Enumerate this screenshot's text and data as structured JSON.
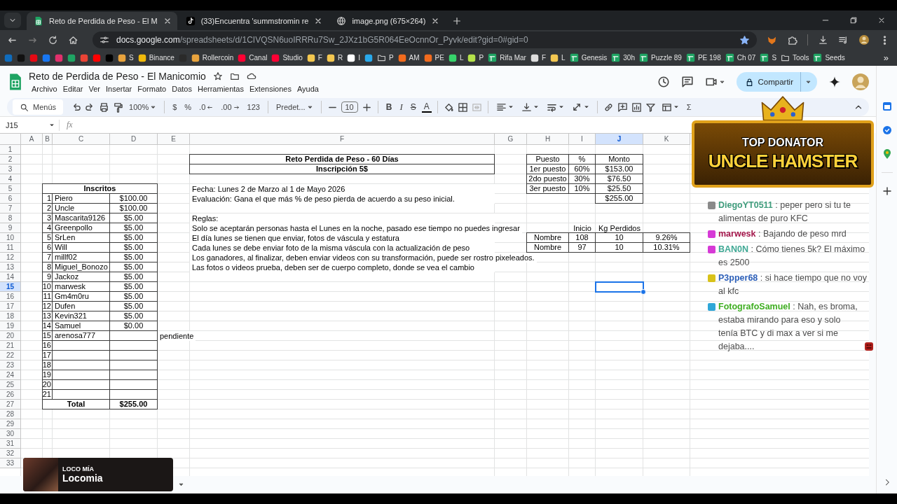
{
  "browser": {
    "tabs": [
      {
        "title": "Reto de Perdida de Peso - El M",
        "kind": "sheets",
        "selected": true
      },
      {
        "title": "(33)Encuentra 'summstromin re",
        "kind": "tiktok",
        "selected": false
      },
      {
        "title": "image.png (675×264)",
        "kind": "globe",
        "selected": false
      }
    ],
    "url": {
      "host": "docs.google.com",
      "path": "/spreadsheets/d/1CIVQSN6uoIRRRu7Sw_2JXz1bG5R064EeOcnnOr_Pyvk/edit?gid=0#gid=0"
    },
    "bookmarks": [
      {
        "kind": "site",
        "color": "#0f6cbd"
      },
      {
        "kind": "site",
        "color": "#111111"
      },
      {
        "kind": "site",
        "color": "#e50914"
      },
      {
        "kind": "site",
        "color": "#1877f2"
      },
      {
        "kind": "site",
        "color": "#e1306c"
      },
      {
        "kind": "site",
        "color": "#1fa463"
      },
      {
        "kind": "site",
        "color": "#ea4335"
      },
      {
        "kind": "site",
        "color": "#ff0000"
      },
      {
        "kind": "site",
        "color": "#000000"
      },
      {
        "kind": "site",
        "color": "#e8a33d",
        "label": "S"
      },
      {
        "kind": "site",
        "color": "#f0b90b",
        "label": "Binance"
      },
      {
        "kind": "site",
        "color": "#2a2a2a"
      },
      {
        "kind": "site",
        "color": "#e8a33d",
        "label": "Rollercoin"
      },
      {
        "kind": "site",
        "color": "#ff0033",
        "label": "Canal"
      },
      {
        "kind": "site",
        "color": "#ff0034",
        "label": "Studio"
      },
      {
        "kind": "site",
        "color": "#f3c74f",
        "label": "F"
      },
      {
        "kind": "site",
        "color": "#f3c750",
        "label": "R"
      },
      {
        "kind": "site",
        "color": "#ffffff",
        "label": "I"
      },
      {
        "kind": "site",
        "color": "#29a9eb"
      },
      {
        "kind": "folder",
        "label": "P"
      },
      {
        "kind": "site",
        "color": "#f26b1d",
        "label": "AM"
      },
      {
        "kind": "site",
        "color": "#f26b1e",
        "label": "PE"
      },
      {
        "kind": "site",
        "color": "#37d36b",
        "label": "L"
      },
      {
        "kind": "site",
        "color": "#b5e24a",
        "label": "P"
      },
      {
        "kind": "sheets",
        "label": "Rifa Mar"
      },
      {
        "kind": "site",
        "color": "#dddddd",
        "label": "F"
      },
      {
        "kind": "site",
        "color": "#f3c751",
        "label": "L"
      },
      {
        "kind": "sheets",
        "label": "Genesis"
      },
      {
        "kind": "sheets",
        "label": "30h"
      },
      {
        "kind": "sheets",
        "label": "Puzzle 89"
      },
      {
        "kind": "sheets",
        "label": "PE 198"
      },
      {
        "kind": "sheets",
        "label": "Ch 07"
      },
      {
        "kind": "sheets",
        "label": "S"
      },
      {
        "kind": "folder",
        "label": "Tools"
      },
      {
        "kind": "sheets",
        "label": "Seeds"
      }
    ],
    "more": "»"
  },
  "doc": {
    "title": "Reto de Perdida de Peso - El Manicomio",
    "menus": [
      "Archivo",
      "Editar",
      "Ver",
      "Insertar",
      "Formato",
      "Datos",
      "Herramientas",
      "Extensiones",
      "Ayuda"
    ],
    "share": "Compartir"
  },
  "toolbar": [
    {
      "kind": "search",
      "label": "Menús"
    },
    {
      "kind": "undo"
    },
    {
      "kind": "redo"
    },
    {
      "kind": "print"
    },
    {
      "kind": "paint"
    },
    {
      "kind": "select",
      "label": "100%"
    },
    {
      "kind": "sep"
    },
    {
      "kind": "text",
      "label": "$"
    },
    {
      "kind": "text",
      "label": "%"
    },
    {
      "kind": "decrease",
      "label": ".0"
    },
    {
      "kind": "increase",
      "label": ".00"
    },
    {
      "kind": "text",
      "label": "123"
    },
    {
      "kind": "sep"
    },
    {
      "kind": "select",
      "label": "Predet..."
    },
    {
      "kind": "sep"
    },
    {
      "kind": "minus"
    },
    {
      "kind": "size",
      "label": "10"
    },
    {
      "kind": "plus"
    },
    {
      "kind": "sep"
    },
    {
      "kind": "bold",
      "label": "B"
    },
    {
      "kind": "italic",
      "label": "I"
    },
    {
      "kind": "strike",
      "label": "S"
    },
    {
      "kind": "color",
      "label": "A"
    },
    {
      "kind": "sep"
    },
    {
      "kind": "fill"
    },
    {
      "kind": "borders"
    },
    {
      "kind": "merge"
    },
    {
      "kind": "sep"
    },
    {
      "kind": "align"
    },
    {
      "kind": "valign"
    },
    {
      "kind": "wrap"
    },
    {
      "kind": "rotate"
    },
    {
      "kind": "sep"
    },
    {
      "kind": "link"
    },
    {
      "kind": "comment"
    },
    {
      "kind": "chart"
    },
    {
      "kind": "filter"
    },
    {
      "kind": "views"
    },
    {
      "kind": "sigma",
      "label": "Σ"
    },
    {
      "kind": "collapse"
    }
  ],
  "formula_bar": {
    "name_box": "J15",
    "fx": "fx"
  },
  "sheet": {
    "columns": [
      {
        "label": "A",
        "selected": false
      },
      {
        "label": "B",
        "selected": false
      },
      {
        "label": "C",
        "selected": false
      },
      {
        "label": "D",
        "selected": false
      },
      {
        "label": "E",
        "selected": false
      },
      {
        "label": "F",
        "selected": false
      },
      {
        "label": "G",
        "selected": false
      },
      {
        "label": "H",
        "selected": false
      },
      {
        "label": "I",
        "selected": false
      },
      {
        "label": "J",
        "selected": true
      },
      {
        "label": "K",
        "selected": false
      }
    ],
    "rows": [
      {
        "label": "1",
        "selected": false
      },
      {
        "label": "2",
        "selected": false
      },
      {
        "label": "3",
        "selected": false
      },
      {
        "label": "4",
        "selected": false
      },
      {
        "label": "5",
        "selected": false
      },
      {
        "label": "6",
        "selected": false
      },
      {
        "label": "7",
        "selected": false
      },
      {
        "label": "8",
        "selected": false
      },
      {
        "label": "9",
        "selected": false
      },
      {
        "label": "10",
        "selected": false
      },
      {
        "label": "11",
        "selected": false
      },
      {
        "label": "12",
        "selected": false
      },
      {
        "label": "13",
        "selected": false
      },
      {
        "label": "14",
        "selected": false
      },
      {
        "label": "15",
        "selected": true
      },
      {
        "label": "16",
        "selected": false
      },
      {
        "label": "17",
        "selected": false
      },
      {
        "label": "18",
        "selected": false
      },
      {
        "label": "19",
        "selected": false
      },
      {
        "label": "20",
        "selected": false
      },
      {
        "label": "21",
        "selected": false
      },
      {
        "label": "22",
        "selected": false
      },
      {
        "label": "23",
        "selected": false
      },
      {
        "label": "24",
        "selected": false
      },
      {
        "label": "25",
        "selected": false
      },
      {
        "label": "26",
        "selected": false
      },
      {
        "label": "27",
        "selected": false
      },
      {
        "label": "28",
        "selected": false
      },
      {
        "label": "29",
        "selected": false
      },
      {
        "label": "30",
        "selected": false
      },
      {
        "label": "31",
        "selected": false
      },
      {
        "label": "32",
        "selected": false
      },
      {
        "label": "33",
        "selected": false
      }
    ],
    "challenge": {
      "title": "Reto Perdida de Peso - 60 Días",
      "subtitle": "Inscripción 5$",
      "paragraphs": [
        [
          "Fecha: Lunes 2 de Marzo al 1 de Mayo 2026",
          "Evaluación: Gana el que más % de peso pierda de acuerdo a su peso inicial."
        ],
        [
          "Reglas:",
          "Solo se aceptarán personas hasta el Lunes en la noche, pasado ese tiempo no puedes ingresar",
          "El día lunes se tienen que enviar, fotos de váscula y estatura",
          "Cada lunes se debe enviar foto de la misma váscula con la actualización de peso",
          "Los ganadores, al finalizar, deben enviar videos con su transformación, puede ser rostro pixeleados.",
          "Las fotos o videos prueba, deben ser de cuerpo completo, donde se vea el cambio"
        ]
      ]
    },
    "entries": {
      "title": "Inscritos",
      "rows": [
        {
          "number": "1",
          "name": "Piero",
          "amount": "$100.00"
        },
        {
          "number": "2",
          "name": "Uncle",
          "amount": "$100.00"
        },
        {
          "number": "3",
          "name": "Mascarita9126",
          "amount": "$5.00"
        },
        {
          "number": "4",
          "name": "Greenpollo",
          "amount": "$5.00"
        },
        {
          "number": "5",
          "name": "SrLen",
          "amount": "$5.00"
        },
        {
          "number": "6",
          "name": "Will",
          "amount": "$5.00"
        },
        {
          "number": "7",
          "name": "millf02",
          "amount": "$5.00"
        },
        {
          "number": "8",
          "name": "Miguel_Bonozo",
          "amount": "$5.00"
        },
        {
          "number": "9",
          "name": "Jackoz",
          "amount": "$5.00"
        },
        {
          "number": "10",
          "name": "marwesk",
          "amount": "$5.00"
        },
        {
          "number": "11",
          "name": "Gm4m0ru",
          "amount": "$5.00"
        },
        {
          "number": "12",
          "name": "Dufen",
          "amount": "$5.00"
        },
        {
          "number": "13",
          "name": "Kevin321",
          "amount": "$5.00"
        },
        {
          "number": "14",
          "name": "Samuel",
          "amount": "$0.00"
        },
        {
          "number": "15",
          "name": "arenosa777",
          "note": "pendiente"
        },
        {
          "number": "16"
        },
        {
          "number": "17"
        },
        {
          "number": "18"
        },
        {
          "number": "19"
        },
        {
          "number": "20"
        },
        {
          "number": "21"
        }
      ],
      "total": {
        "label": "Total",
        "amount": "$255.00"
      }
    },
    "prizes": {
      "columns": [
        "Puesto",
        "%",
        "Monto"
      ],
      "rows": [
        [
          "1er puesto",
          "60%",
          "$153.00"
        ],
        [
          "2do puesto",
          "30%",
          "$76.50"
        ],
        [
          "3er puesto",
          "10%",
          "$25.50"
        ]
      ],
      "total": "$255.00"
    },
    "progress": {
      "columns": [
        "",
        "Inicio",
        "Kg Perdidos"
      ],
      "rows": [
        [
          "Nombre",
          "108",
          "10",
          "9.26%"
        ],
        [
          "Nombre",
          "97",
          "10",
          "10.31%"
        ]
      ]
    }
  },
  "stream": {
    "donator": {
      "label": "TOP DONATOR",
      "name": "UNCLE HAMSTER"
    },
    "chat": [
      {
        "user": "DiegoYT0511",
        "text": ": peper pero si tu te alimentas de puro KFC",
        "color": "#3f9c7c",
        "kind": "viewer"
      },
      {
        "user": "marwesk",
        "text": ": Bajando de peso mrd",
        "color": "#a3154a",
        "kind": "sub"
      },
      {
        "user": "BAN0N",
        "text": ": Cómo tienes 5k? El máximo es 2500",
        "color": "#3fa894",
        "kind": "sub"
      },
      {
        "user": "P3pper68",
        "text": ": si hace tiempo que no voy al kfc",
        "color": "#2c5fb8",
        "kind": "vip"
      },
      {
        "user": "FotografoSamuel",
        "text": ": Nah, es broma, estaba mirando para eso y solo tenía BTC y di max a ver si me dejaba....",
        "color": "#3fae22",
        "kind": "artist"
      }
    ],
    "music": {
      "label": "LOCO MÍA",
      "artist": "Locomia"
    }
  }
}
